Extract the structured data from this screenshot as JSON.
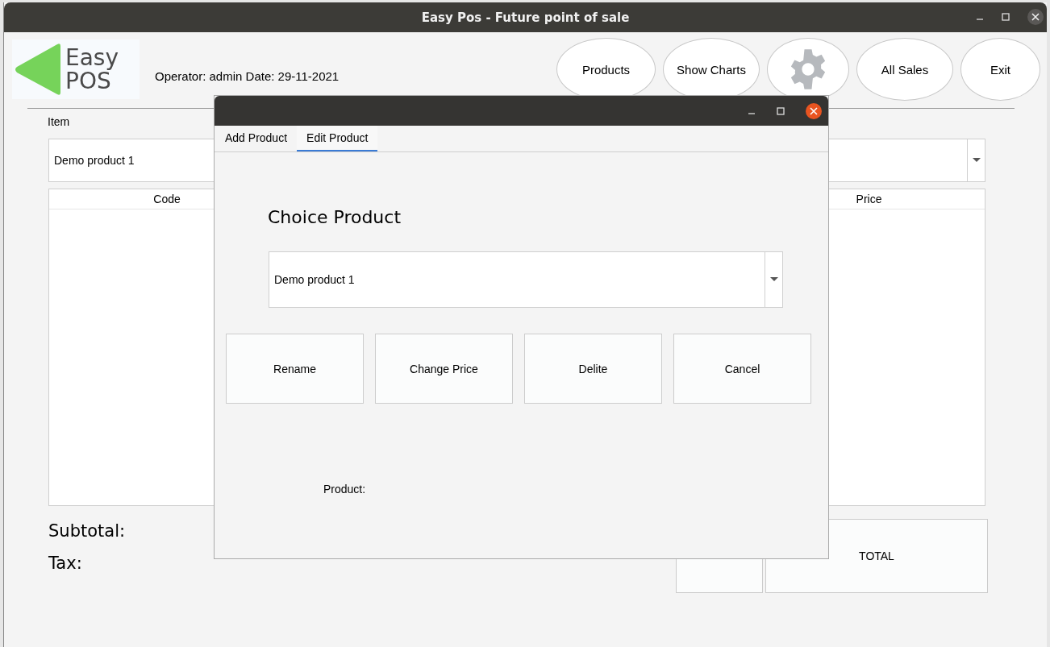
{
  "window": {
    "title": "Easy Pos - Future point of sale"
  },
  "logo": {
    "line_1": "Easy",
    "line_2": "POS"
  },
  "operator_info": "Operator: admin  Date: 29-11-2021",
  "toolbar": [
    {
      "kind": "text",
      "label": "Products"
    },
    {
      "kind": "text",
      "label": "Show Charts"
    },
    {
      "kind": "settings"
    },
    {
      "kind": "text",
      "label": "All Sales"
    },
    {
      "kind": "text",
      "label": "Exit"
    }
  ],
  "item": {
    "label": "Item",
    "value": "Demo product 1"
  },
  "table": {
    "columns": [
      "Code",
      "Price"
    ]
  },
  "totals": {
    "subtotal_label": "Subtotal:",
    "tax_label": "Tax:",
    "total_label": "TOTAL"
  },
  "dialog": {
    "tabs": [
      {
        "label": "Add Product",
        "selected": false
      },
      {
        "label": "Edit Product",
        "selected": true
      }
    ],
    "heading": "Choice Product",
    "product_select": "Demo product 1",
    "buttons": [
      "Rename",
      "Change Price",
      "Delite",
      "Cancel"
    ],
    "product_label": "Product:"
  }
}
